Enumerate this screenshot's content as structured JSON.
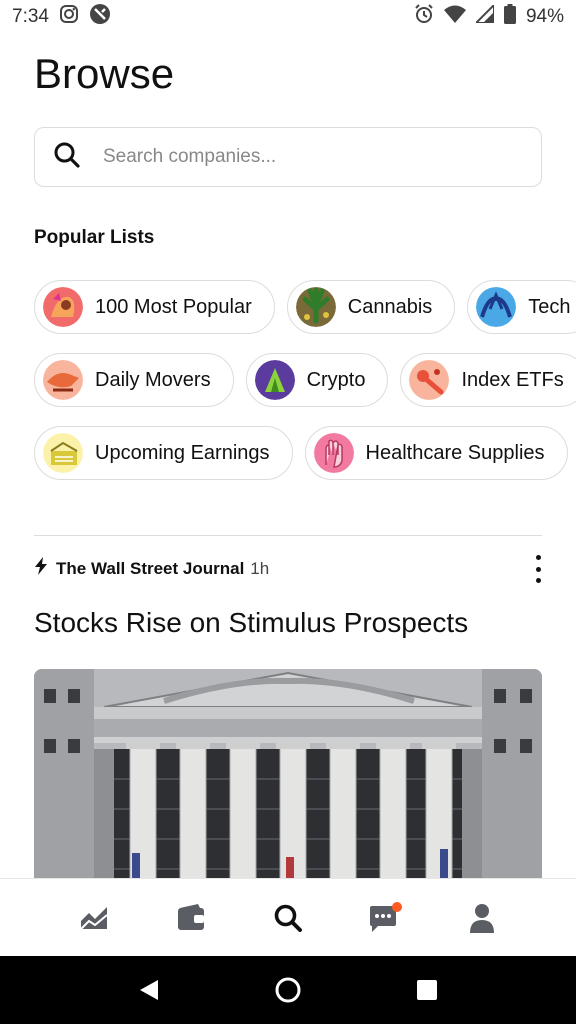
{
  "status_bar": {
    "time": "7:34",
    "battery": "94%",
    "left_icons": [
      "instagram-icon",
      "app-notification-icon"
    ],
    "right_icons": [
      "alarm-icon",
      "wifi-icon",
      "signal-icon",
      "battery-icon"
    ]
  },
  "page": {
    "title": "Browse"
  },
  "search": {
    "placeholder": "Search companies..."
  },
  "popular_lists": {
    "title": "Popular Lists",
    "rows": [
      [
        {
          "label": "100 Most Popular",
          "icon": "popular-list-icon"
        },
        {
          "label": "Cannabis",
          "icon": "cannabis-list-icon"
        },
        {
          "label": "Tech",
          "icon": "tech-list-icon"
        }
      ],
      [
        {
          "label": "Daily Movers",
          "icon": "daily-movers-list-icon"
        },
        {
          "label": "Crypto",
          "icon": "crypto-list-icon"
        },
        {
          "label": "Index ETFs",
          "icon": "index-etfs-list-icon"
        }
      ],
      [
        {
          "label": "Upcoming Earnings",
          "icon": "upcoming-earnings-list-icon"
        },
        {
          "label": "Healthcare Supplies",
          "icon": "healthcare-supplies-list-icon"
        }
      ]
    ]
  },
  "news": {
    "source": "The Wall Street Journal",
    "time": "1h",
    "headline": "Stocks Rise on Stimulus Prospects",
    "image": "stock-exchange-building-photo"
  },
  "tab_bar": {
    "items": [
      "chart-icon",
      "wallet-icon",
      "search-icon",
      "messages-icon",
      "account-icon"
    ],
    "active": "search-icon",
    "badge_color": "#ff5a1f"
  },
  "nav_bar": {
    "items": [
      "back-icon",
      "home-icon",
      "overview-icon"
    ]
  }
}
